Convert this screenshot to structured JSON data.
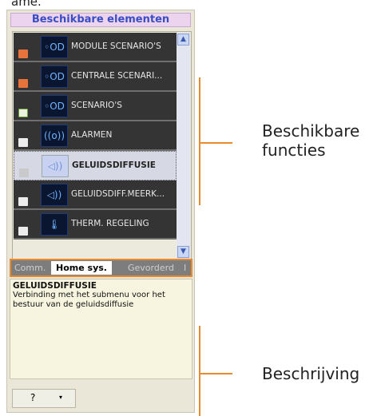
{
  "top_text": "ame.",
  "panel": {
    "title": "Beschikbare elementen",
    "items": [
      {
        "label": "MODULE SCENARIO'S",
        "icon": "scenario-module-icon",
        "badge": "orange-arrow-badge"
      },
      {
        "label": "CENTRALE SCENARI...",
        "icon": "scenario-central-icon",
        "badge": "orange-arrow-badge"
      },
      {
        "label": "SCENARIO'S",
        "icon": "scenario-icon",
        "badge": "green-list-badge"
      },
      {
        "label": "ALARMEN",
        "icon": "alarm-icon",
        "badge": "white-edit-badge"
      },
      {
        "label": "GELUIDSDIFFUSIE",
        "icon": "speaker-icon",
        "badge": "white-edit-badge",
        "selected": true
      },
      {
        "label": "GELUIDSDIFF.MEERK...",
        "icon": "speaker-multi-icon",
        "badge": "white-edit-badge"
      },
      {
        "label": "THERM. REGELING",
        "icon": "thermometer-icon",
        "badge": "white-edit-badge"
      }
    ],
    "tabs": [
      "Comm.",
      "Home sys.",
      "Gevorderd",
      "I"
    ],
    "active_tab": "Home sys.",
    "description": {
      "title": "GELUIDSDIFFUSIE",
      "text": "Verbinding met het submenu voor het bestuur van de geluidsdiffusie"
    },
    "help_button": "?",
    "help_dropdown": "▾"
  },
  "annotations": {
    "functions_line1": "Beschikbare",
    "functions_line2": "functies",
    "description": "Beschrijving"
  },
  "colors": {
    "accent": "#ea8a2e",
    "title_text": "#3a4ec4",
    "title_bg": "#ecd3ee"
  }
}
